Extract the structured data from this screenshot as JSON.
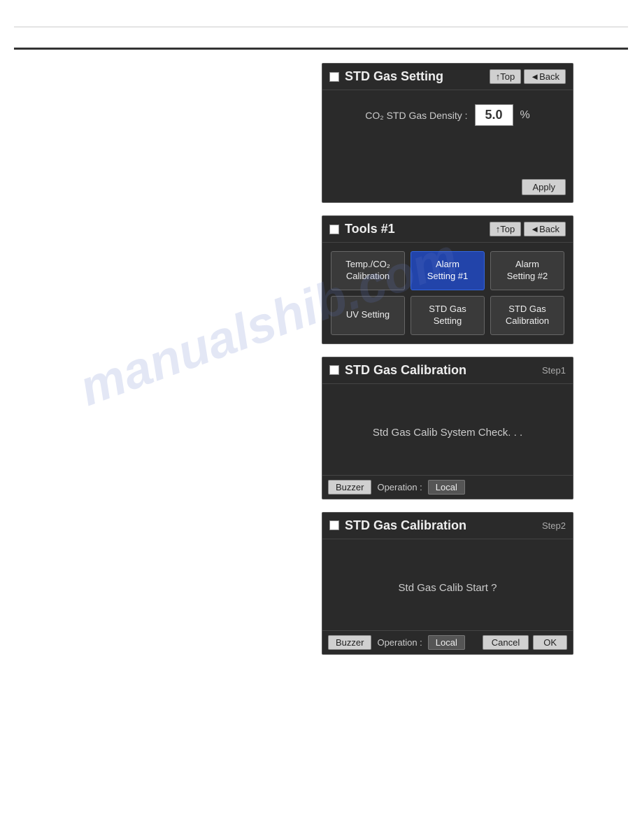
{
  "decorators": {
    "watermark": "manualshib.com"
  },
  "panels": {
    "std_gas_setting": {
      "title": "STD Gas Setting",
      "checkbox_label": "checkbox",
      "nav": {
        "top_label": "↑Top",
        "back_label": "◄Back"
      },
      "co2_label": "CO₂ STD Gas Density :",
      "value": "5.0",
      "unit": "%",
      "apply_label": "Apply"
    },
    "tools1": {
      "title": "Tools #1",
      "nav": {
        "top_label": "↑Top",
        "back_label": "◄Back"
      },
      "buttons": [
        {
          "id": "temp-co2-cal",
          "label": "Temp./CO₂\nCalibration",
          "active": false
        },
        {
          "id": "alarm-set1",
          "label": "Alarm\nSetting #1",
          "active": true
        },
        {
          "id": "alarm-set2",
          "label": "Alarm\nSetting #2",
          "active": false
        },
        {
          "id": "uv-setting",
          "label": "UV Setting",
          "active": false
        },
        {
          "id": "std-gas-set",
          "label": "STD Gas\nSetting",
          "active": false
        },
        {
          "id": "std-gas-cal",
          "label": "STD Gas\nCalibration",
          "active": false
        }
      ]
    },
    "std_gas_calib_step1": {
      "title": "STD Gas Calibration",
      "step_label": "Step1",
      "message": "Std Gas Calib System Check. . .",
      "buzzer_label": "Buzzer",
      "operation_label": "Operation :",
      "operation_value": "Local"
    },
    "std_gas_calib_step2": {
      "title": "STD Gas Calibration",
      "step_label": "Step2",
      "message": "Std Gas Calib Start ?",
      "buzzer_label": "Buzzer",
      "operation_label": "Operation :",
      "operation_value": "Local",
      "cancel_label": "Cancel",
      "ok_label": "OK"
    }
  }
}
